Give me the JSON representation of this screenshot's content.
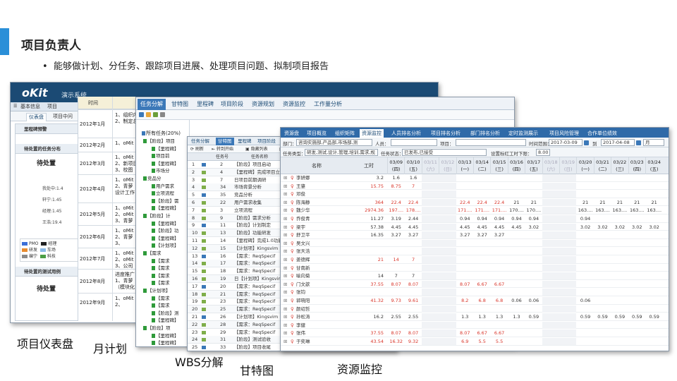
{
  "slide": {
    "title": "项目负责人",
    "bullet": "能够做计划、分任务、跟踪项目进展、处理项目问题、拟制项目报告",
    "captions": [
      "项目仪表盘",
      "月计划",
      "WBS分解",
      "甘特图",
      "资源监控"
    ]
  },
  "dashboard": {
    "logo": "oKit",
    "system_name": "演示系统",
    "nav": [
      "基本信息",
      "项目"
    ],
    "tabs": [
      "仪表盘",
      "项目中问"
    ],
    "sections": [
      "里程碑预警",
      "待处置的任务分布",
      "待处置的测试用例"
    ],
    "pending_label": "待处置",
    "pending_label2": "待处置",
    "stats": [
      "我处中:1.4",
      "轩宁:1.45",
      "经理:1.45",
      "王浩:19.4"
    ],
    "legend": [
      {
        "name": "PMO",
        "color": "#3b6fd8"
      },
      {
        "name": "研发",
        "color": "#e88b2e"
      },
      {
        "name": "编宁",
        "color": "#8a8a8a"
      },
      {
        "name": "车场",
        "color": "#8bbbe8"
      },
      {
        "name": "科技",
        "color": "#4c9e45"
      },
      {
        "name": "经理",
        "color": "#222222"
      }
    ]
  },
  "month_plan": {
    "header": "时间",
    "rows": [
      {
        "month": "2012年1月",
        "items": [
          "1、组织内任务树",
          "2、制定总"
        ]
      },
      {
        "month": "2012年2月",
        "items": [
          "1、oMit"
        ]
      },
      {
        "month": "2012年3月",
        "items": [
          "1、oMit",
          "2、新项目",
          "3、校图"
        ]
      },
      {
        "month": "2012年4月",
        "items": [
          "1、oMit",
          "2、青萝",
          "设计工作"
        ]
      },
      {
        "month": "2012年5月",
        "items": [
          "1、oMit",
          "2、oMit",
          "3、青萝"
        ]
      },
      {
        "month": "2012年6月",
        "items": [
          "1、oMit",
          "2、青萝",
          "3、"
        ]
      },
      {
        "month": "2012年7月",
        "items": [
          "1、oMit",
          "2、oMit",
          "3、公司"
        ]
      },
      {
        "month": "2012年8月",
        "items": [
          "进度推广",
          "1、青萝",
          "（模块化"
        ]
      },
      {
        "month": "2012年9月",
        "items": [
          "1、oMit",
          "2、"
        ]
      }
    ]
  },
  "wbs": {
    "tabs": [
      "任务分解",
      "甘特图",
      "里程碑",
      "项目阶段",
      "资源规划",
      "资源监控",
      "工作量分析"
    ],
    "root": "所有任务(20%)",
    "tree": [
      "【阶段】项目",
      "【里程碑】",
      "项目前",
      "【里程碑】",
      "市场分",
      "竞品分",
      "用户需求",
      "立项流程",
      "【阶段】需",
      "【里程碑】",
      "【阶段】计",
      "【里程碑】",
      "【阶段】功",
      "【里程碑】",
      "【计划项】",
      "【需求",
      "【需求",
      "【需求",
      "【需求",
      "【需求",
      "【计划项】",
      "【需求",
      "【需求",
      "【阶段】测",
      "【里程碑】",
      "【阶段】项",
      "【里程碑】",
      "【里程碑】"
    ]
  },
  "gantt": {
    "tabs": [
      "任务分解",
      "甘特图",
      "里程碑",
      "项目阶段"
    ],
    "toolbar": [
      "刷新",
      "转到开始",
      "隐藏列表",
      "显示"
    ],
    "headers": [
      "任务号",
      "任务名称"
    ],
    "rows": [
      {
        "n": "1",
        "id": "2",
        "name": "【阶段】项目启动"
      },
      {
        "n": "2",
        "id": "4",
        "name": "【里程碑】完成项目立项"
      },
      {
        "n": "3",
        "id": "7",
        "name": "日项目前期调研"
      },
      {
        "n": "4",
        "id": "34",
        "name": "市场背景分析"
      },
      {
        "n": "5",
        "id": "35",
        "name": "竞品分析"
      },
      {
        "n": "6",
        "id": "22",
        "name": "用户需求收集"
      },
      {
        "n": "7",
        "id": "3",
        "name": "立项流程"
      },
      {
        "n": "8",
        "id": "9",
        "name": "【阶段】需求分析"
      },
      {
        "n": "9",
        "id": "11",
        "name": "【阶段】计划制定"
      },
      {
        "n": "10",
        "id": "13",
        "name": "【阶段】功能研发"
      },
      {
        "n": "11",
        "id": "14",
        "name": "【里程碑】完成1.0功能"
      },
      {
        "n": "12",
        "id": "15",
        "name": "【计划项】Kingsvim"
      },
      {
        "n": "13",
        "id": "16",
        "name": "【需求：ReqSpecif"
      },
      {
        "n": "14",
        "id": "17",
        "name": "【需求：ReqSpecif"
      },
      {
        "n": "15",
        "id": "18",
        "name": "【需求：ReqSpecif"
      },
      {
        "n": "16",
        "id": "19",
        "name": "日【计划项】Kingsvim"
      },
      {
        "n": "17",
        "id": "20",
        "name": "【需求：ReqSpecif"
      },
      {
        "n": "18",
        "id": "21",
        "name": "【需求：ReqSpecif"
      },
      {
        "n": "19",
        "id": "23",
        "name": "【需求：ReqSpecif"
      },
      {
        "n": "20",
        "id": "25",
        "name": "【需求：ReqSpecif"
      },
      {
        "n": "21",
        "id": "26",
        "name": "【计划项】Kingsvim"
      },
      {
        "n": "22",
        "id": "28",
        "name": "【需求：ReqSpecif"
      },
      {
        "n": "23",
        "id": "29",
        "name": "【需求：ReqSpecif"
      },
      {
        "n": "24",
        "id": "31",
        "name": "【阶段】测试验收"
      },
      {
        "n": "25",
        "id": "33",
        "name": "【阶段】项目收尾"
      }
    ]
  },
  "resource": {
    "tabs": [
      "资源盘",
      "项目概览",
      "组织矩阵",
      "资源监控",
      "人员排名分析",
      "项目排名分析",
      "部门排名分析",
      "定时监测展示",
      "项目风险管理",
      "合作单位绩效"
    ],
    "filter": {
      "dept_label": "部门：",
      "dept_value": "咨询实施部,产品部,市场部,测",
      "person_label": "人员：",
      "project_label": "项目：",
      "range_label": "时间范围：",
      "date_from": "2017-03-09",
      "to_label": "到",
      "date_to": "2017-04-08",
      "unit": "月"
    },
    "filter2": {
      "type_label": "任务类型：",
      "type_value": "研发,测试,设计,管理,培训,需求,规",
      "status_label": "任务状态：",
      "status_value": "已发布,已接受",
      "threshold_label": "设置标红工时下限：",
      "threshold_value": "8.00"
    },
    "columns": {
      "name": "名称",
      "hours": "工时"
    },
    "days": [
      {
        "d": "03/09",
        "w": "(四)",
        "we": false
      },
      {
        "d": "03/10",
        "w": "(五)",
        "we": false
      },
      {
        "d": "03/11",
        "w": "(六)",
        "we": true
      },
      {
        "d": "03/12",
        "w": "(日)",
        "we": true
      },
      {
        "d": "03/13",
        "w": "(一)",
        "we": false
      },
      {
        "d": "03/14",
        "w": "(二)",
        "we": false
      },
      {
        "d": "03/15",
        "w": "(三)",
        "we": false
      },
      {
        "d": "03/16",
        "w": "(四)",
        "we": false
      },
      {
        "d": "03/17",
        "w": "(五)",
        "we": false
      },
      {
        "d": "03/18",
        "w": "(六)",
        "we": true
      },
      {
        "d": "03/19",
        "w": "(日)",
        "we": true
      },
      {
        "d": "03/20",
        "w": "(一)",
        "we": false
      },
      {
        "d": "03/21",
        "w": "(二)",
        "we": false
      },
      {
        "d": "03/22",
        "w": "(三)",
        "we": false
      },
      {
        "d": "03/23",
        "w": "(四)",
        "we": false
      },
      {
        "d": "03/24",
        "w": "(五)",
        "we": false
      }
    ],
    "rows": [
      {
        "name": "李妍娜",
        "hours": "3.2",
        "red": false,
        "v": [
          "1.6",
          "1.6",
          "",
          "",
          "",
          "",
          "",
          "",
          "",
          "",
          "",
          "",
          "",
          "",
          "",
          ""
        ]
      },
      {
        "name": "王肇",
        "hours": "15.75",
        "red": true,
        "v": [
          "8.75",
          "7",
          "",
          "",
          "",
          "",
          "",
          "",
          "",
          "",
          "",
          "",
          "",
          "",
          "",
          ""
        ]
      },
      {
        "name": "邓俊",
        "hours": "",
        "red": false,
        "v": [
          "",
          "",
          "",
          "",
          "",
          "",
          "",
          "",
          "",
          "",
          "",
          "",
          "",
          "",
          "",
          ""
        ]
      },
      {
        "name": "陈海静",
        "hours": "364",
        "red": true,
        "v": [
          "22.4",
          "22.4",
          "",
          "",
          "22.4",
          "22.4",
          "22.4",
          "21",
          "21",
          "",
          "",
          "21",
          "21",
          "21",
          "21",
          "21"
        ]
      },
      {
        "name": "魏少华",
        "hours": "2974.36",
        "red": true,
        "v": [
          "197....",
          "178....",
          "",
          "",
          "171....",
          "171....",
          "171....",
          "170....",
          "170....",
          "",
          "",
          "163....",
          "163....",
          "163....",
          "163....",
          "163...."
        ]
      },
      {
        "name": "乔俊青",
        "hours": "11.27",
        "red": false,
        "v": [
          "3.19",
          "2.44",
          "",
          "",
          "0.94",
          "0.94",
          "0.94",
          "0.94",
          "0.94",
          "",
          "",
          "0.94",
          "",
          "",
          "",
          ""
        ]
      },
      {
        "name": "梁宇",
        "hours": "57.38",
        "red": false,
        "v": [
          "4.45",
          "4.45",
          "",
          "",
          "4.45",
          "4.45",
          "4.45",
          "4.45",
          "3.02",
          "",
          "",
          "3.02",
          "3.02",
          "3.02",
          "3.02",
          "3.02"
        ]
      },
      {
        "name": "舒卫平",
        "hours": "16.35",
        "red": false,
        "v": [
          "3.27",
          "3.27",
          "",
          "",
          "3.27",
          "3.27",
          "3.27",
          "",
          "",
          "",
          "",
          "",
          "",
          "",
          "",
          ""
        ]
      },
      {
        "name": "吴文兴",
        "hours": "",
        "red": false,
        "v": [
          "",
          "",
          "",
          "",
          "",
          "",
          "",
          "",
          "",
          "",
          "",
          "",
          "",
          "",
          "",
          ""
        ]
      },
      {
        "name": "张天浩",
        "hours": "",
        "red": false,
        "v": [
          "",
          "",
          "",
          "",
          "",
          "",
          "",
          "",
          "",
          "",
          "",
          "",
          "",
          "",
          "",
          ""
        ]
      },
      {
        "name": "姜德辉",
        "hours": "21",
        "red": true,
        "v": [
          "14",
          "7",
          "",
          "",
          "",
          "",
          "",
          "",
          "",
          "",
          "",
          "",
          "",
          "",
          "",
          ""
        ]
      },
      {
        "name": "甘南新",
        "hours": "",
        "red": false,
        "v": [
          "",
          "",
          "",
          "",
          "",
          "",
          "",
          "",
          "",
          "",
          "",
          "",
          "",
          "",
          "",
          ""
        ]
      },
      {
        "name": "喻向菊",
        "hours": "14",
        "red": false,
        "v": [
          "7",
          "7",
          "",
          "",
          "",
          "",
          "",
          "",
          "",
          "",
          "",
          "",
          "",
          "",
          "",
          ""
        ]
      },
      {
        "name": "门文歆",
        "hours": "37.55",
        "red": true,
        "v": [
          "8.07",
          "8.07",
          "",
          "",
          "8.07",
          "6.67",
          "6.67",
          "",
          "",
          "",
          "",
          "",
          "",
          "",
          "",
          ""
        ]
      },
      {
        "name": "张钧",
        "hours": "",
        "red": false,
        "v": [
          "",
          "",
          "",
          "",
          "",
          "",
          "",
          "",
          "",
          "",
          "",
          "",
          "",
          "",
          "",
          ""
        ]
      },
      {
        "name": "郭晓阳",
        "hours": "41.32",
        "red": true,
        "v": [
          "9.73",
          "9.61",
          "",
          "",
          "8.2",
          "6.8",
          "6.8",
          "0.06",
          "0.06",
          "",
          "",
          "0.06",
          "",
          "",
          "",
          ""
        ]
      },
      {
        "name": "颜绍哲",
        "hours": "",
        "red": false,
        "v": [
          "",
          "",
          "",
          "",
          "",
          "",
          "",
          "",
          "",
          "",
          "",
          "",
          "",
          "",
          "",
          ""
        ]
      },
      {
        "name": "孙松涛",
        "hours": "16.2",
        "red": false,
        "v": [
          "2.55",
          "2.55",
          "",
          "",
          "1.3",
          "1.3",
          "1.3",
          "1.3",
          "0.59",
          "",
          "",
          "0.59",
          "0.59",
          "0.59",
          "0.59",
          "0.59"
        ]
      },
      {
        "name": "李健",
        "hours": "",
        "red": false,
        "v": [
          "",
          "",
          "",
          "",
          "",
          "",
          "",
          "",
          "",
          "",
          "",
          "",
          "",
          "",
          "",
          ""
        ]
      },
      {
        "name": "张伟",
        "hours": "37.55",
        "red": true,
        "v": [
          "8.07",
          "8.07",
          "",
          "",
          "8.07",
          "6.67",
          "6.67",
          "",
          "",
          "",
          "",
          "",
          "",
          "",
          "",
          ""
        ]
      },
      {
        "name": "于奕琳",
        "hours": "43.54",
        "red": true,
        "v": [
          "16.32",
          "9.32",
          "",
          "",
          "6.9",
          "5.5",
          "5.5",
          "",
          "",
          "",
          "",
          "",
          "",
          "",
          "",
          ""
        ]
      }
    ]
  }
}
